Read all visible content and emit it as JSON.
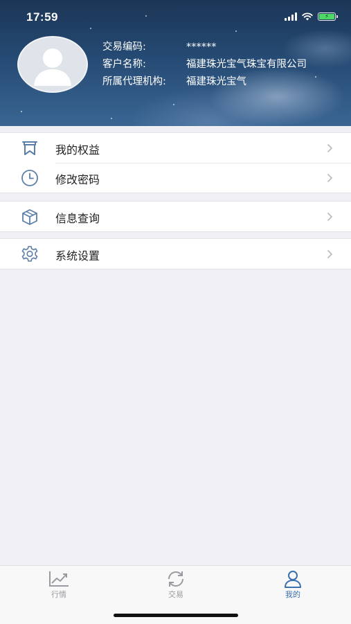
{
  "status_bar": {
    "time": "17:59"
  },
  "profile": {
    "rows": [
      {
        "label": "交易编码:",
        "value": "******"
      },
      {
        "label": "客户名称:",
        "value": "福建珠光宝气珠宝有限公司"
      },
      {
        "label": "所属代理机构:",
        "value": "福建珠光宝气"
      }
    ]
  },
  "menu": {
    "groups": [
      {
        "items": [
          {
            "label": "我的权益",
            "icon": "bookmark-icon"
          },
          {
            "label": "修改密码",
            "icon": "clock-icon"
          }
        ]
      },
      {
        "items": [
          {
            "label": "信息查询",
            "icon": "box-icon"
          }
        ]
      },
      {
        "items": [
          {
            "label": "系统设置",
            "icon": "gear-icon"
          }
        ]
      }
    ]
  },
  "tabbar": {
    "tabs": [
      {
        "label": "行情",
        "icon": "chart-icon",
        "active": false
      },
      {
        "label": "交易",
        "icon": "refresh-icon",
        "active": false
      },
      {
        "label": "我的",
        "icon": "user-icon",
        "active": true
      }
    ]
  },
  "colors": {
    "accent": "#3a6fb0",
    "icon_blue": "#5b7fa6",
    "battery": "#4cd964"
  }
}
